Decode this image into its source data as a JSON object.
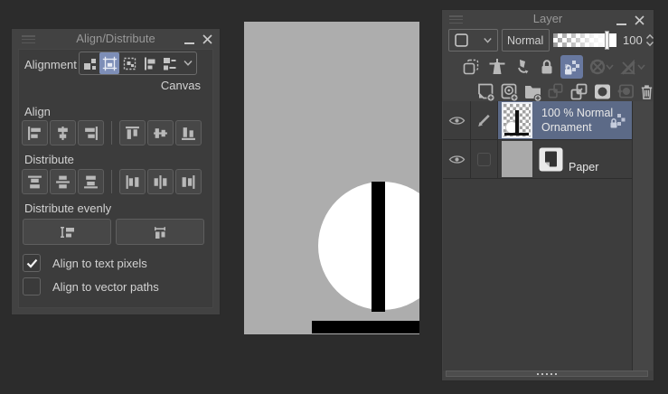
{
  "align_panel": {
    "title": "Align/Distribute",
    "window_icons": [
      "hamburger-menu",
      "minimize",
      "close"
    ],
    "alignment_base": {
      "label": "Alignment ba",
      "value": "Canvas",
      "selected_index": 1,
      "option_icons": [
        "align-to-objects",
        "align-to-transform-frame",
        "align-to-selection",
        "align-to-guide",
        "align-to-multiple-objects"
      ]
    },
    "align": {
      "label": "Align",
      "buttons": [
        "align-left",
        "align-horizontal-center",
        "align-right",
        "align-top",
        "align-vertical-center",
        "align-bottom"
      ]
    },
    "distribute": {
      "label": "Distribute",
      "buttons": [
        "distribute-top",
        "distribute-vertical-center",
        "distribute-bottom",
        "distribute-left",
        "distribute-horizontal-center",
        "distribute-right"
      ]
    },
    "distribute_evenly": {
      "label": "Distribute evenly",
      "buttons": [
        "distribute-evenly-vertical",
        "distribute-evenly-horizontal"
      ]
    },
    "checkboxes": [
      {
        "label": "Align to text pixels",
        "checked": true
      },
      {
        "label": "Align to vector paths",
        "checked": false
      }
    ]
  },
  "canvas": {
    "background": "#adadad",
    "shapes": [
      "white-circle",
      "black-vertical-bar",
      "black-horizontal-bar"
    ]
  },
  "layer_panel": {
    "title": "Layer",
    "window_icons": [
      "hamburger-menu",
      "minimize",
      "close"
    ],
    "blend_mode": "Normal",
    "opacity": "100",
    "toolbar_row1": [
      "clip-to-layer-below",
      "reference-layer",
      "draft-layer",
      "lock-layer",
      "lock-transparent-pixels",
      "enable-mask",
      "ruler-visibility"
    ],
    "toolbar_row1_active": "lock-transparent-pixels",
    "toolbar_row2": [
      "new-raster-layer",
      "new-vector-layer",
      "new-folder",
      "transfer-to-lower-layer",
      "merge-to-lower-layer",
      "create-layer-mask",
      "apply-mask",
      "delete-layer"
    ],
    "layers": [
      {
        "info": "100 % Normal",
        "name": "Ornament",
        "selected": true,
        "visible": true,
        "editing": true,
        "alpha_locked": true
      },
      {
        "name": "Paper",
        "selected": false,
        "visible": true
      }
    ]
  }
}
